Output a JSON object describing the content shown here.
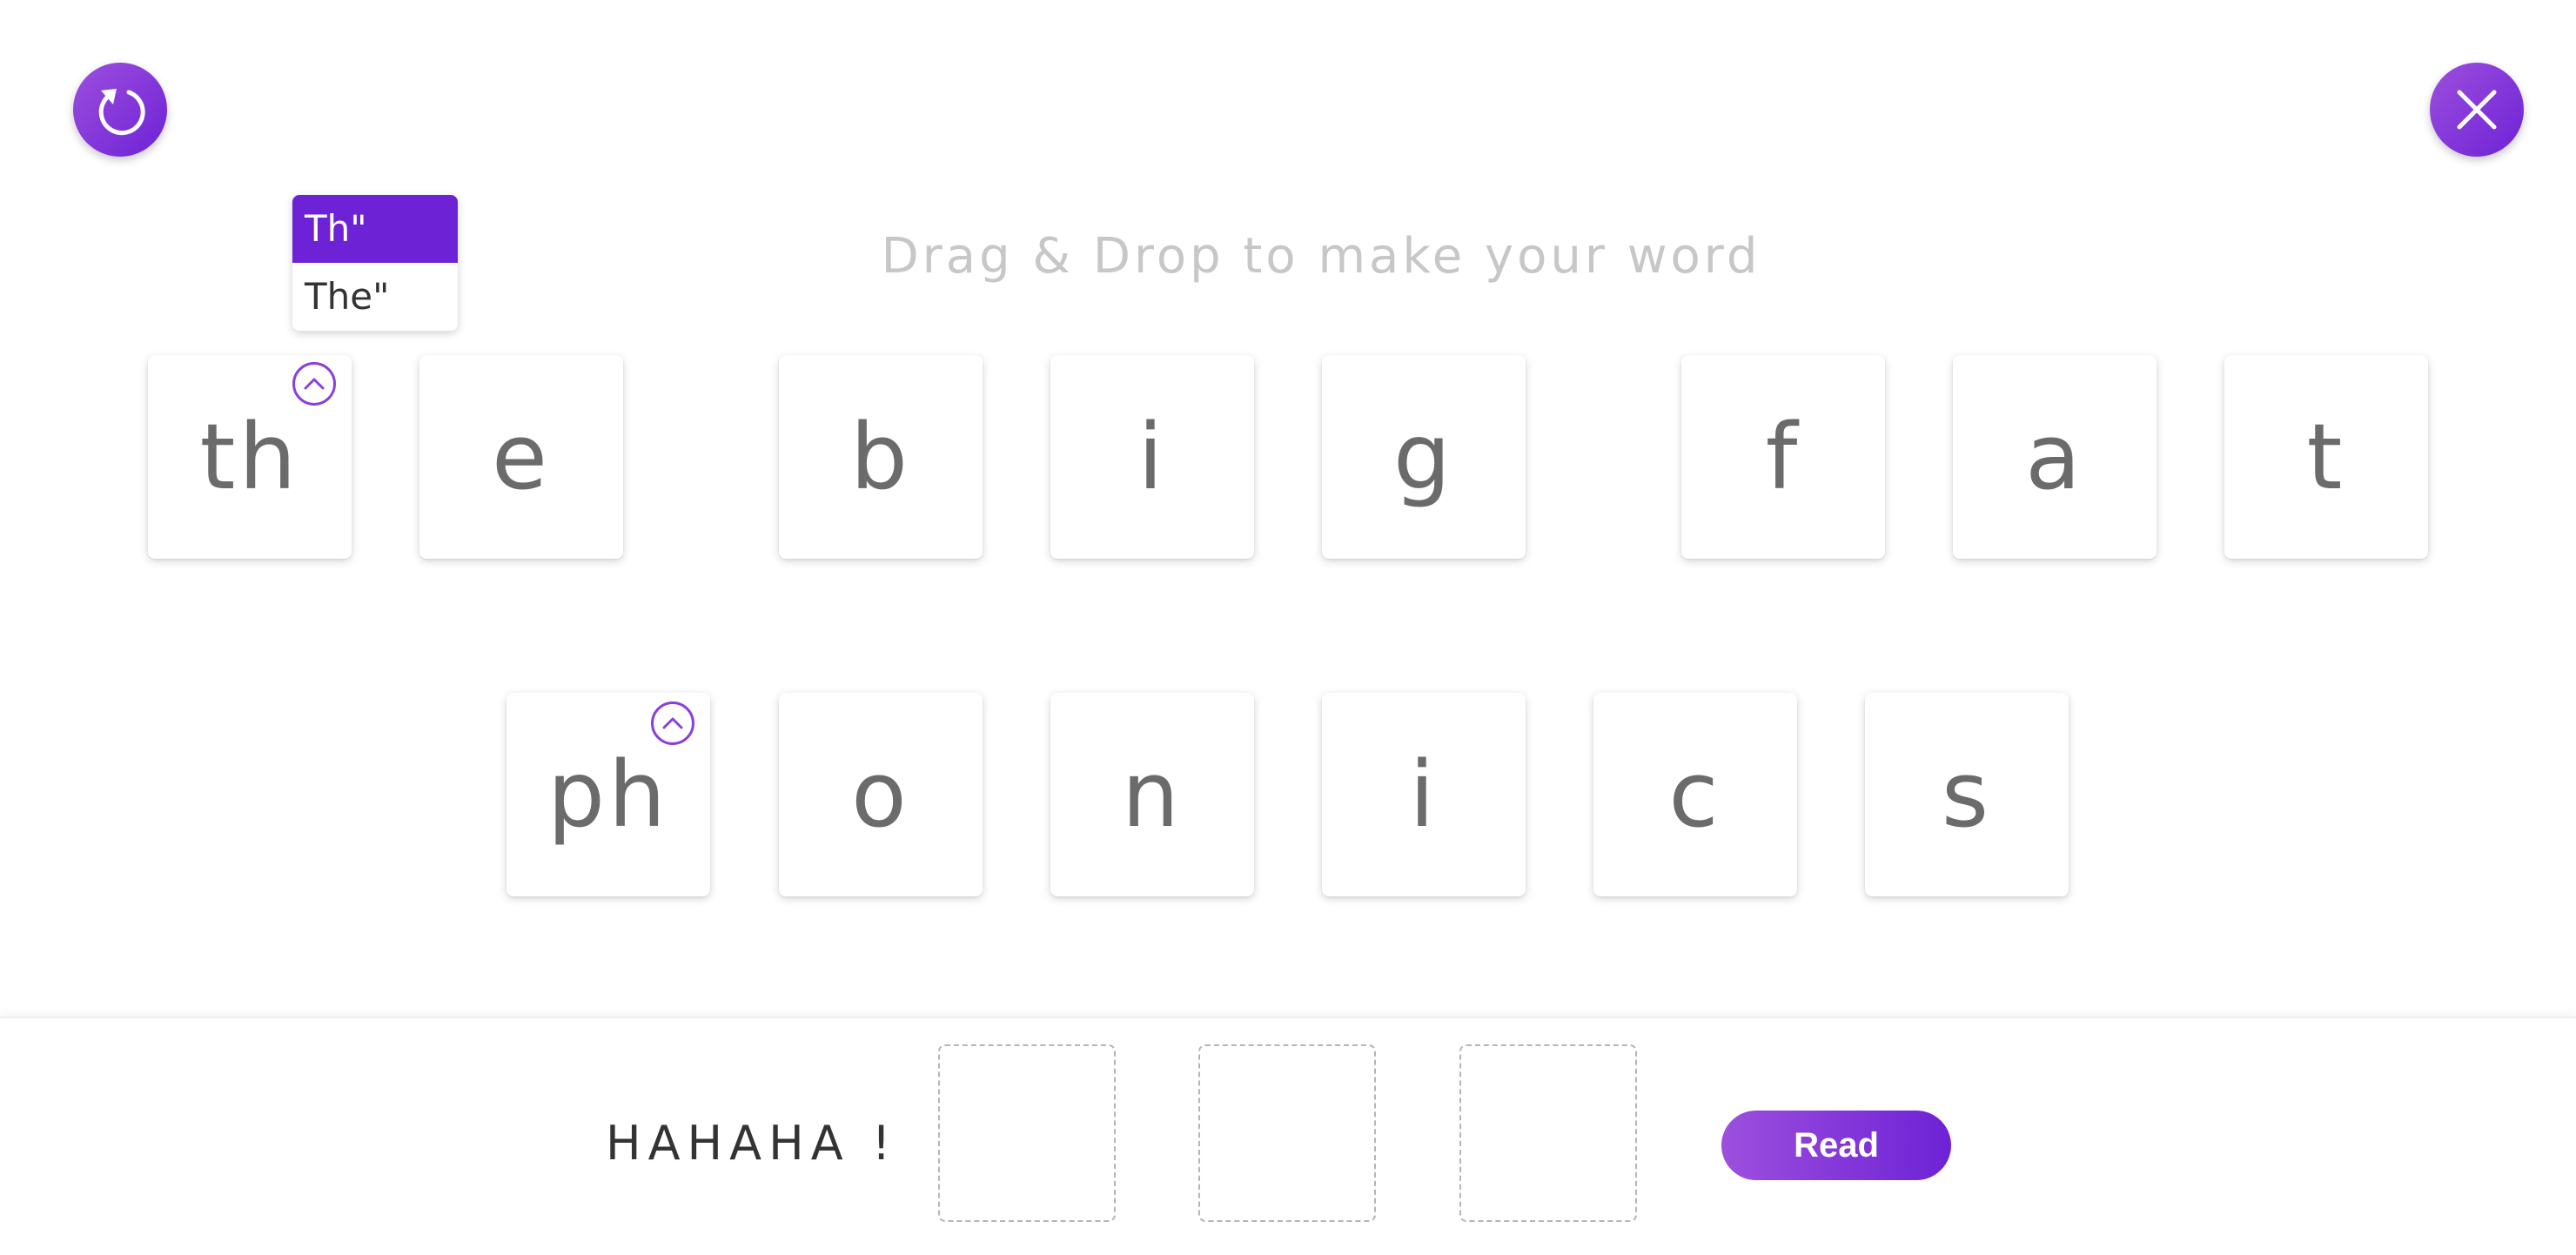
{
  "header": {
    "reset_icon": "reset-icon",
    "close_icon": "close-icon",
    "accent_color": "#6d22d6",
    "accent_light": "#9d4fdd"
  },
  "instruction": "Drag & Drop to make your word",
  "phoneme_dropdown": {
    "options": [
      {
        "label": "Th\"",
        "selected": true
      },
      {
        "label": "The\"",
        "selected": false
      }
    ]
  },
  "tiles_row1": [
    "th",
    "e",
    "b",
    "i",
    "g",
    "f",
    "a",
    "t"
  ],
  "tiles_row2": [
    "ph",
    "o",
    "n",
    "i",
    "c",
    "s"
  ],
  "expandable_tiles": [
    "th",
    "ph"
  ],
  "answer": {
    "feedback": "HAHAHA !",
    "slot_count": 3,
    "read_label": "Read"
  }
}
